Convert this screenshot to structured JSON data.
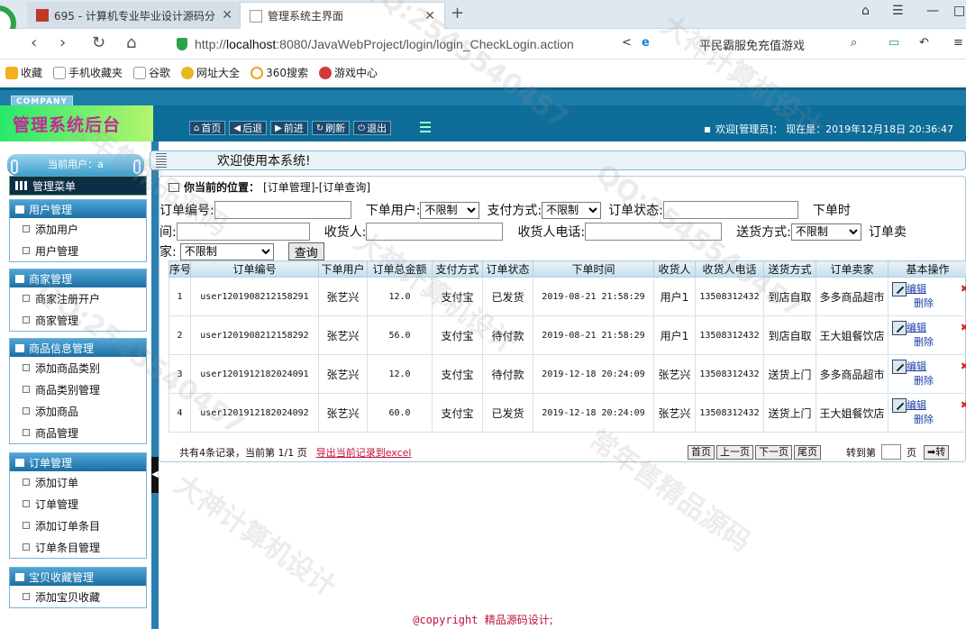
{
  "browser": {
    "tabs": [
      {
        "label": "695 - 计算机专业毕业设计源码分"
      },
      {
        "label": "管理系统主界面"
      }
    ],
    "new_tab": "+",
    "url_scheme": "http://",
    "url_host": "localhost",
    "url_rest": ":8080/JavaWebProject/login/login_CheckLogin.action",
    "search_hint": "平民霸服免充值游戏",
    "bookmarks": [
      "收藏",
      "手机收藏夹",
      "谷歌",
      "网址大全",
      "360搜索",
      "游戏中心"
    ]
  },
  "header": {
    "company": "COMPANY",
    "brand": "管理系统后台",
    "nav": [
      "首页",
      "后退",
      "前进",
      "刷新",
      "退出"
    ],
    "welcome": "欢迎[管理员]：",
    "now_label": "现在是：",
    "now_value": "2019年12月18日 20:36:47"
  },
  "sidebar": {
    "current_user": "当前用户：a",
    "menu_title": "管理菜单",
    "groups": [
      {
        "title": "用户管理",
        "items": [
          "添加用户",
          "用户管理"
        ]
      },
      {
        "title": "商家管理",
        "items": [
          "商家注册开户",
          "商家管理"
        ]
      },
      {
        "title": "商品信息管理",
        "items": [
          "添加商品类别",
          "商品类别管理",
          "添加商品",
          "商品管理"
        ]
      },
      {
        "title": "订单管理",
        "items": [
          "添加订单",
          "订单管理",
          "添加订单条目",
          "订单条目管理"
        ]
      },
      {
        "title": "宝贝收藏管理",
        "items": [
          "添加宝贝收藏"
        ]
      }
    ]
  },
  "main": {
    "welcome": "欢迎使用本系统!",
    "position_label": "你当前的位置：",
    "position_path": "[订单管理]-[订单查询]",
    "form": {
      "order_no_label": "订单编号:",
      "user_label": "下单用户:",
      "user_value": "不限制",
      "pay_label": "支付方式:",
      "pay_value": "不限制",
      "status_label": "订单状态:",
      "time_label_a": "下单时",
      "time_label_b": "间:",
      "receiver_label": "收货人:",
      "phone_label": "收货人电话:",
      "ship_label": "送货方式:",
      "ship_value": "不限制",
      "seller_label_a": "订单卖",
      "seller_label_b": "家:",
      "seller_value": "不限制",
      "query": "查询"
    },
    "table": {
      "headers": [
        "序号",
        "订单编号",
        "下单用户",
        "订单总金额",
        "支付方式",
        "订单状态",
        "下单时间",
        "收货人",
        "收货人电话",
        "送货方式",
        "订单卖家",
        "基本操作"
      ],
      "edit": "编辑",
      "delete": "删除",
      "rows": [
        [
          "1",
          "user1201908212158291",
          "张艺兴",
          "12.0",
          "支付宝",
          "已发货",
          "2019-08-21 21:58:29",
          "用户1",
          "13508312432",
          "到店自取",
          "多多商品超市"
        ],
        [
          "2",
          "user1201908212158292",
          "张艺兴",
          "56.0",
          "支付宝",
          "待付款",
          "2019-08-21 21:58:29",
          "用户1",
          "13508312432",
          "到店自取",
          "王大姐餐饮店"
        ],
        [
          "3",
          "user1201912182024091",
          "张艺兴",
          "12.0",
          "支付宝",
          "待付款",
          "2019-12-18 20:24:09",
          "张艺兴",
          "13508312432",
          "送货上门",
          "多多商品超市"
        ],
        [
          "4",
          "user1201912182024092",
          "张艺兴",
          "60.0",
          "支付宝",
          "已发货",
          "2019-12-18 20:24:09",
          "张艺兴",
          "13508312432",
          "送货上门",
          "王大姐餐饮店"
        ]
      ]
    },
    "pager": {
      "info": "共有4条记录，当前第 1/1 页",
      "export": "导出当前记录到excel",
      "first": "首页",
      "prev": "上一页",
      "next": "下一页",
      "last": "尾页",
      "goto_label": "转到第",
      "page_unit": "页",
      "go": "➡转"
    }
  },
  "footer": {
    "copyright": "@copyright",
    "text": "精品源码设计;"
  },
  "watermarks": [
    "QQ:2545540457",
    "大神计算机设计",
    "常年售精品源码"
  ],
  "colors": {
    "brand_green": "#27e86b",
    "brand_text": "#c22a93",
    "header_blue": "#0e6d99",
    "footer_red": "#c0123b"
  }
}
